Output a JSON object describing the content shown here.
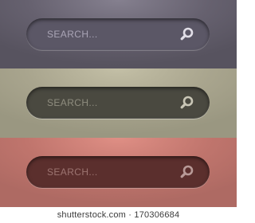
{
  "bars": [
    {
      "placeholder": "SEARCH...",
      "icon": "search-icon"
    },
    {
      "placeholder": "SEARCH...",
      "icon": "search-icon"
    },
    {
      "placeholder": "SEARCH...",
      "icon": "search-icon"
    }
  ],
  "colors": {
    "band_purple": "#66616f",
    "band_khaki": "#a9a58e",
    "band_red": "#c0756d",
    "field_purple": "#5b5766",
    "field_khaki": "#4a4940",
    "field_red": "#5b2f2d"
  },
  "watermark": "shutterstock.com · 170306684"
}
